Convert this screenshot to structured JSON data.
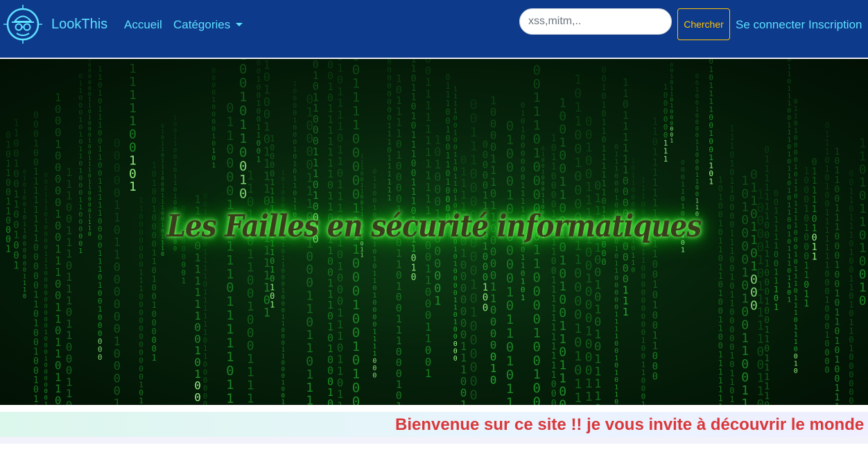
{
  "navbar": {
    "brand_name": "LookThis",
    "links": {
      "home": "Accueil",
      "categories": "Catégories",
      "login": "Se connecter",
      "signup": "Inscription"
    },
    "search": {
      "placeholder": "xss,mitm,..",
      "value": ""
    },
    "search_button": "Chercher",
    "colors": {
      "background": "#0d3a8a",
      "link": "#5ee0ff",
      "button": "#ffc107"
    }
  },
  "hero": {
    "title": "Les Failles en sécurité informatiques",
    "background": "matrix-digital-rain",
    "colors": {
      "rain": "#3cff3c",
      "glow": "#1fd11f"
    }
  },
  "marquee": {
    "text": "Bienvenue sur ce site !! je vous invite à découvrir le monde",
    "color": "#d9383a"
  },
  "icons": {
    "logo": "hacker-detective-icon",
    "caret": "caret-down-icon"
  }
}
